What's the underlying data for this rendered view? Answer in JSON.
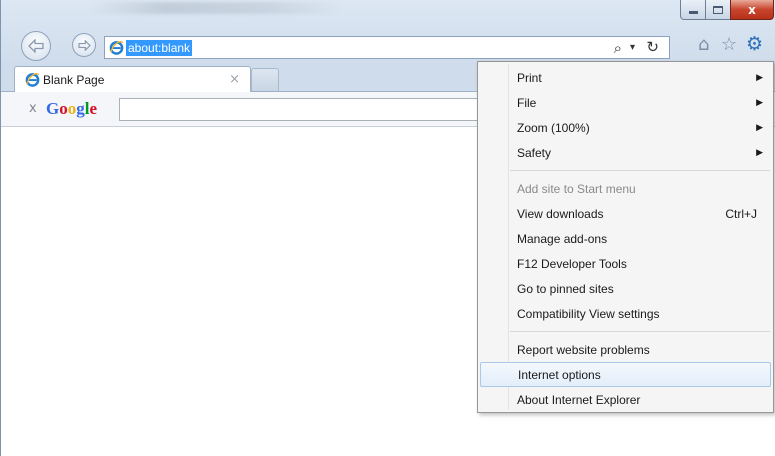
{
  "browser": {
    "address_url": "about:blank",
    "tab_title": "Blank Page",
    "tab_close": "×",
    "close_glyph": "x"
  },
  "toolbar": {
    "google_close": "x",
    "google_logo": [
      {
        "ch": "G",
        "color": "#3369e8"
      },
      {
        "ch": "o",
        "color": "#d50f25"
      },
      {
        "ch": "o",
        "color": "#eeb211"
      },
      {
        "ch": "g",
        "color": "#3369e8"
      },
      {
        "ch": "l",
        "color": "#009925"
      },
      {
        "ch": "e",
        "color": "#d50f25"
      }
    ]
  },
  "menu": {
    "items": [
      {
        "label": "Print",
        "submenu": true
      },
      {
        "label": "File",
        "submenu": true
      },
      {
        "label": "Zoom (100%)",
        "submenu": true
      },
      {
        "label": "Safety",
        "submenu": true
      },
      {
        "label": "Add site to Start menu",
        "disabled": true
      },
      {
        "label": "View downloads",
        "shortcut": "Ctrl+J"
      },
      {
        "label": "Manage add-ons"
      },
      {
        "label": "F12 Developer Tools"
      },
      {
        "label": "Go to pinned sites"
      },
      {
        "label": "Compatibility View settings"
      },
      {
        "label": "Report website problems"
      },
      {
        "label": "Internet options",
        "highlighted": true
      },
      {
        "label": "About Internet Explorer"
      }
    ]
  },
  "colors": {
    "accent_selection": "#3399ff",
    "close_button": "#c8452c",
    "menu_highlight_border": "#aac8e8"
  }
}
